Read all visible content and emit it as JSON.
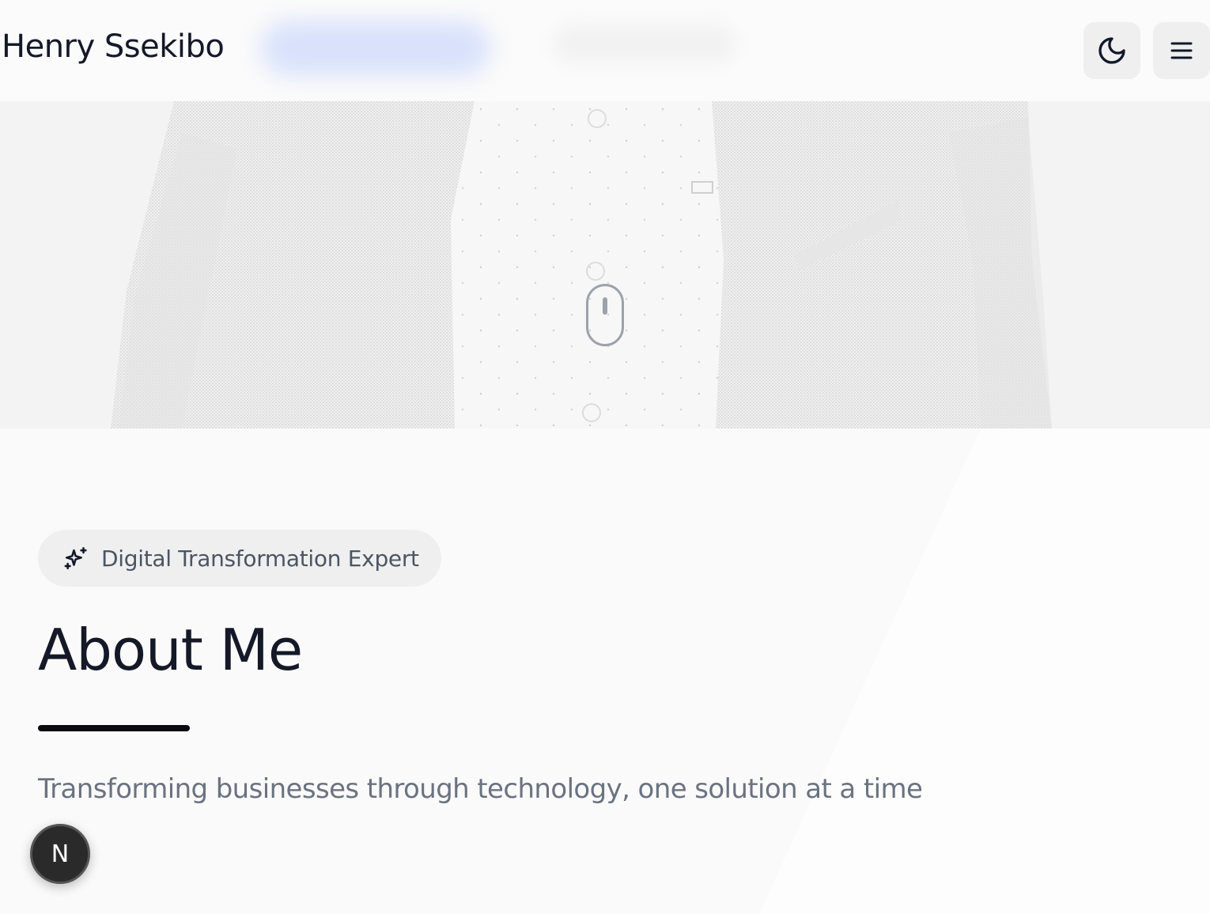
{
  "header": {
    "brand": "Henry Ssekibo",
    "theme_toggle_icon": "moon-icon",
    "menu_icon": "hamburger-menu-icon"
  },
  "hero": {
    "image": "portrait-photo-jacket-shirt",
    "scroll_indicator_icon": "mouse-scroll-icon"
  },
  "about": {
    "badge_icon": "sparkles-icon",
    "badge_label": "Digital Transformation Expert",
    "title": "About Me",
    "tagline": "Transforming businesses through technology, one solution at a time"
  },
  "floating_badge": {
    "label": "N"
  },
  "colors": {
    "background": "#fcfcfc",
    "text_primary": "#141827",
    "text_muted": "#6b7280",
    "badge_bg": "#efefef",
    "nav_highlight": "#d9e2fb"
  }
}
